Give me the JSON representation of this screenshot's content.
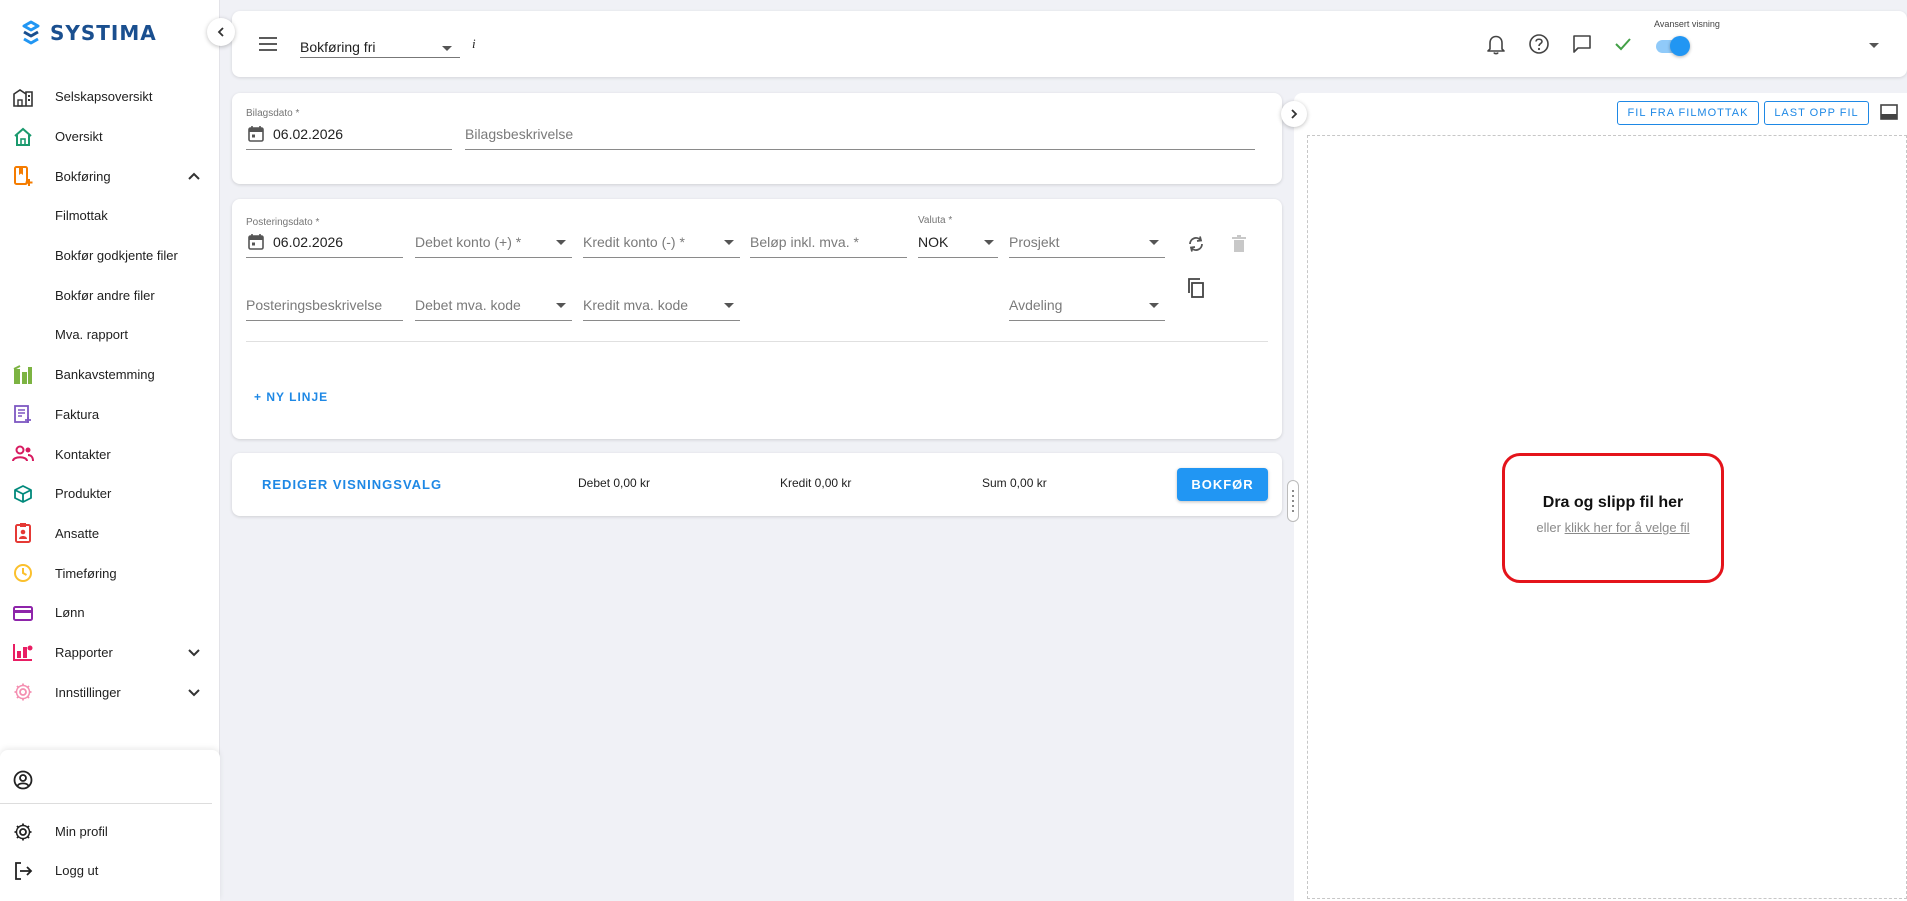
{
  "brand": {
    "name": "SYSTIMA",
    "color": "#1a4f8f"
  },
  "sidebar": {
    "items": [
      {
        "label": "Selskapsoversikt",
        "icon": "building-icon"
      },
      {
        "label": "Oversikt",
        "icon": "home-icon"
      },
      {
        "label": "Bokføring",
        "icon": "bookkeeping-icon",
        "expanded": true
      },
      {
        "label": "Filmottak"
      },
      {
        "label": "Bokfør godkjente filer"
      },
      {
        "label": "Bokfør andre filer"
      },
      {
        "label": "Mva. rapport"
      },
      {
        "label": "Bankavstemming",
        "icon": "bank-icon"
      },
      {
        "label": "Faktura",
        "icon": "invoice-icon"
      },
      {
        "label": "Kontakter",
        "icon": "contacts-icon"
      },
      {
        "label": "Produkter",
        "icon": "product-box-icon"
      },
      {
        "label": "Ansatte",
        "icon": "employee-badge-icon"
      },
      {
        "label": "Timeføring",
        "icon": "clock-icon"
      },
      {
        "label": "Lønn",
        "icon": "payroll-card-icon"
      },
      {
        "label": "Rapporter",
        "icon": "reports-icon",
        "expanded": false
      },
      {
        "label": "Innstillinger",
        "icon": "settings-gear-icon",
        "expanded": false
      }
    ],
    "bottom": {
      "profile_label": "Min profil",
      "logout_label": "Logg ut"
    }
  },
  "topbar": {
    "journal_type": "Bokføring fri",
    "info_glyph": "i",
    "advanced_view_label": "Avansert visning",
    "advanced_view_on": true
  },
  "voucher": {
    "date_label": "Bilagsdato *",
    "date_value": "06.02.2026",
    "description_placeholder": "Bilagsbeskrivelse"
  },
  "posting": {
    "date_label": "Posteringsdato *",
    "date_value": "06.02.2026",
    "debit_account_placeholder": "Debet konto (+) *",
    "credit_account_placeholder": "Kredit konto (-) *",
    "amount_placeholder": "Beløp inkl. mva. *",
    "currency_label": "Valuta *",
    "currency_value": "NOK",
    "project_placeholder": "Prosjekt",
    "description_placeholder": "Posteringsbeskrivelse",
    "debit_vat_placeholder": "Debet mva. kode",
    "credit_vat_placeholder": "Kredit mva. kode",
    "department_placeholder": "Avdeling",
    "new_line_label": "+ NY LINJE"
  },
  "summary": {
    "edit_view_label": "REDIGER VISNINGSVALG",
    "debit": "Debet 0,00 kr",
    "credit": "Kredit 0,00 kr",
    "sum": "Sum 0,00 kr",
    "submit_label": "BOKFØR"
  },
  "filepanel": {
    "from_inbox_label": "FIL FRA FILMOTTAK",
    "upload_label": "LAST OPP FIL",
    "drop_title": "Dra og slipp fil her",
    "drop_prefix": "eller",
    "drop_link": "klikk her for å velge fil"
  },
  "colors": {
    "accent": "#2196f3",
    "highlight": "#e4141b",
    "success": "#43a047"
  }
}
